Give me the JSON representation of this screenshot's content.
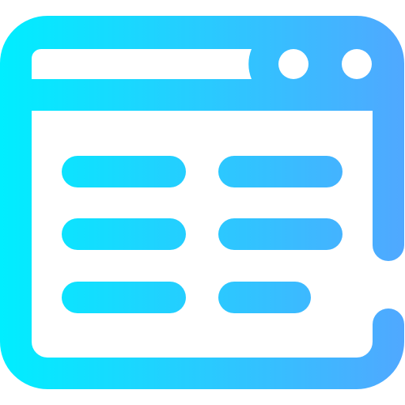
{
  "icon": {
    "name": "browser-window-list-icon",
    "gradient": {
      "start": "#00EEFF",
      "end": "#50A8FF"
    },
    "background": "#FFFFFF"
  }
}
